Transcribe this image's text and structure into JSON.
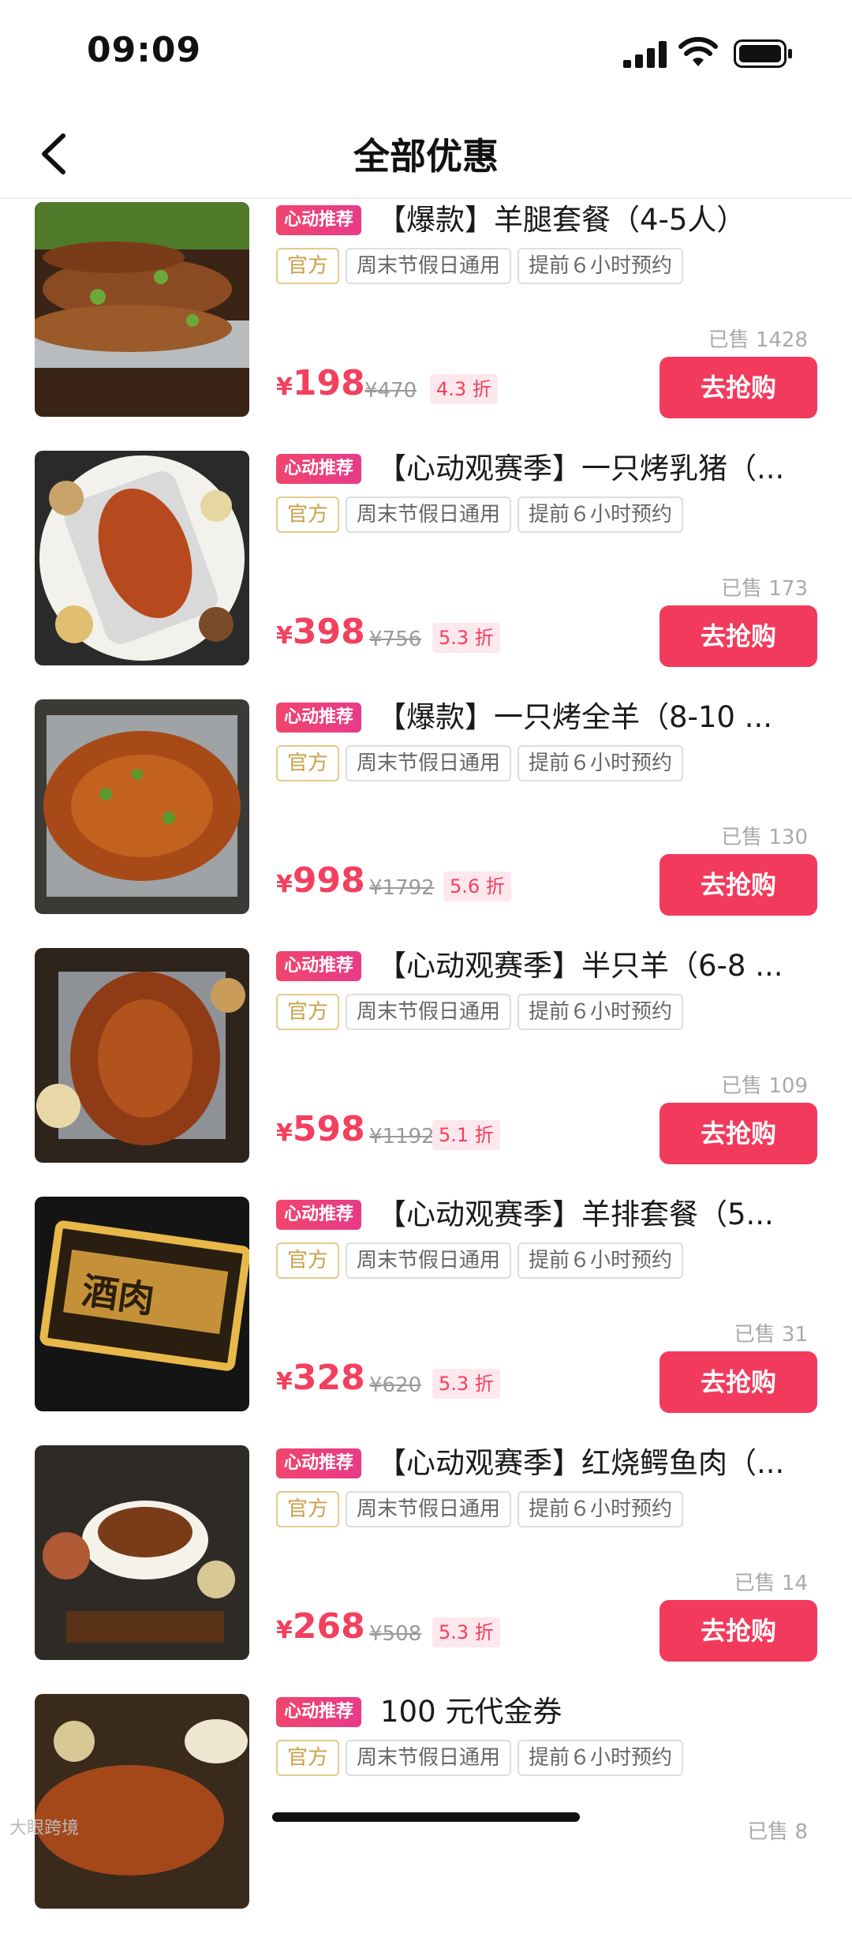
{
  "status_bar": {
    "time": "09:09"
  },
  "nav": {
    "title": "全部优惠"
  },
  "items": [
    {
      "badge": "心动推荐",
      "title": "【爆款】羊腿套餐（4-5人）",
      "tag_official": "官方",
      "tag_weekend": "周末节假日通用",
      "tag_booking": "提前６小时预约",
      "sold": "已售 1428",
      "price_symbol": "¥",
      "price": "198",
      "original_price": "¥470",
      "discount": "4.3 折",
      "buy_label": "去抢购"
    },
    {
      "badge": "心动推荐",
      "title": "【心动观赛季】一只烤乳猪（...",
      "tag_official": "官方",
      "tag_weekend": "周末节假日通用",
      "tag_booking": "提前６小时预约",
      "sold": "已售 173",
      "price_symbol": "¥",
      "price": "398",
      "original_price": "¥756",
      "discount": "5.3 折",
      "buy_label": "去抢购"
    },
    {
      "badge": "心动推荐",
      "title": "【爆款】一只烤全羊（8-10 ...",
      "tag_official": "官方",
      "tag_weekend": "周末节假日通用",
      "tag_booking": "提前６小时预约",
      "sold": "已售 130",
      "price_symbol": "¥",
      "price": "998",
      "original_price": "¥1792",
      "discount": "5.6 折",
      "buy_label": "去抢购"
    },
    {
      "badge": "心动推荐",
      "title": "【心动观赛季】半只羊（6-8 ...",
      "tag_official": "官方",
      "tag_weekend": "周末节假日通用",
      "tag_booking": "提前６小时预约",
      "sold": "已售 109",
      "price_symbol": "¥",
      "price": "598",
      "original_price": "¥1192",
      "discount": "5.1 折",
      "buy_label": "去抢购"
    },
    {
      "badge": "心动推荐",
      "title": "【心动观赛季】羊排套餐（5...",
      "tag_official": "官方",
      "tag_weekend": "周末节假日通用",
      "tag_booking": "提前６小时预约",
      "sold": "已售 31",
      "price_symbol": "¥",
      "price": "328",
      "original_price": "¥620",
      "discount": "5.3 折",
      "buy_label": "去抢购"
    },
    {
      "badge": "心动推荐",
      "title": "【心动观赛季】红烧鳄鱼肉（...",
      "tag_official": "官方",
      "tag_weekend": "周末节假日通用",
      "tag_booking": "提前６小时预约",
      "sold": "已售 14",
      "price_symbol": "¥",
      "price": "268",
      "original_price": "¥508",
      "discount": "5.3 折",
      "buy_label": "去抢购"
    },
    {
      "badge": "心动推荐",
      "title": "100 元代金券",
      "tag_official": "官方",
      "tag_weekend": "周末节假日通用",
      "tag_booking": "提前６小时预约",
      "sold": "已售 8",
      "price_symbol": "",
      "price": "",
      "original_price": "",
      "discount": "",
      "buy_label": ""
    }
  ],
  "watermark": "大眼跨境",
  "colors": {
    "accent": "#f23a5c",
    "badge": "#f0466d",
    "official_tag": "#c9a24b"
  }
}
